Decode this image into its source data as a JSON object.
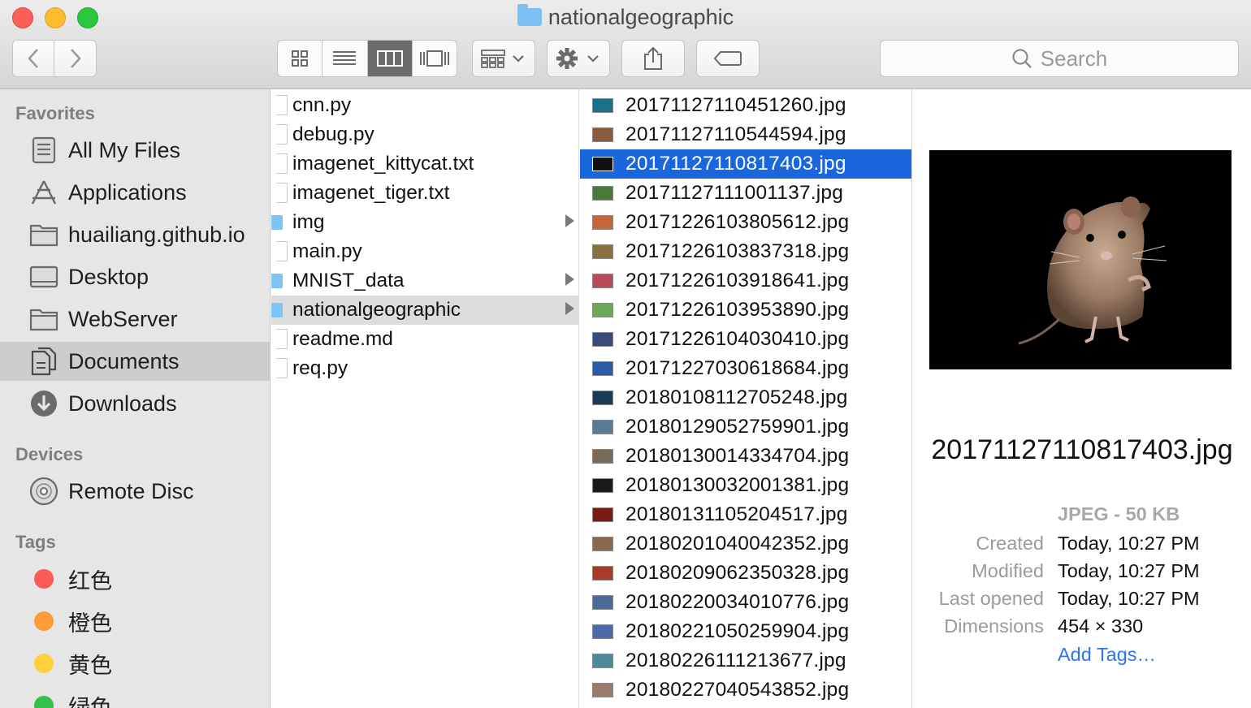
{
  "window": {
    "title": "nationalgeographic"
  },
  "toolbar": {
    "search_placeholder": "Search",
    "icons": [
      "back-chevron-icon",
      "forward-chevron-icon",
      "icon-view-icon",
      "list-view-icon",
      "column-view-icon",
      "cover-flow-icon",
      "arrange-icon",
      "gear-icon",
      "share-icon",
      "tag-icon",
      "magnifier-icon"
    ]
  },
  "sidebar": {
    "favorites_header": "Favorites",
    "favorites": [
      {
        "label": "All My Files",
        "icon": "all-files-icon"
      },
      {
        "label": "Applications",
        "icon": "applications-icon"
      },
      {
        "label": "huailiang.github.io",
        "icon": "folder-icon"
      },
      {
        "label": "Desktop",
        "icon": "desktop-icon"
      },
      {
        "label": "WebServer",
        "icon": "folder-icon"
      },
      {
        "label": "Documents",
        "icon": "documents-icon"
      },
      {
        "label": "Downloads",
        "icon": "download-icon"
      }
    ],
    "devices_header": "Devices",
    "devices": [
      {
        "label": "Remote Disc",
        "icon": "disc-icon"
      }
    ],
    "tags_header": "Tags",
    "tags": [
      {
        "label": "红色",
        "color": "#fc5a54"
      },
      {
        "label": "橙色",
        "color": "#fd9d3a"
      },
      {
        "label": "黄色",
        "color": "#fdd23c"
      },
      {
        "label": "绿色",
        "color": "#36c24a"
      }
    ]
  },
  "column1": {
    "items": [
      {
        "name": "cnn.py",
        "kind": "file"
      },
      {
        "name": "debug.py",
        "kind": "file"
      },
      {
        "name": "imagenet_kittycat.txt",
        "kind": "file"
      },
      {
        "name": "imagenet_tiger.txt",
        "kind": "file"
      },
      {
        "name": "img",
        "kind": "folder"
      },
      {
        "name": "main.py",
        "kind": "file"
      },
      {
        "name": "MNIST_data",
        "kind": "folder"
      },
      {
        "name": "nationalgeographic",
        "kind": "folder"
      },
      {
        "name": "readme.md",
        "kind": "file"
      },
      {
        "name": "req.py",
        "kind": "file"
      }
    ]
  },
  "column2": {
    "items": [
      {
        "name": "20171127110451260.jpg",
        "thumb": "#1a6f8a"
      },
      {
        "name": "20171127110544594.jpg",
        "thumb": "#8a5a3a"
      },
      {
        "name": "20171127110817403.jpg",
        "thumb": "#111111"
      },
      {
        "name": "20171127111001137.jpg",
        "thumb": "#4a7a3a"
      },
      {
        "name": "20171226103805612.jpg",
        "thumb": "#c8643c"
      },
      {
        "name": "20171226103837318.jpg",
        "thumb": "#8a7040"
      },
      {
        "name": "20171226103918641.jpg",
        "thumb": "#b84a5a"
      },
      {
        "name": "20171226103953890.jpg",
        "thumb": "#6aa85a"
      },
      {
        "name": "20171226104030410.jpg",
        "thumb": "#3a4a7a"
      },
      {
        "name": "20171227030618684.jpg",
        "thumb": "#2a5aa8"
      },
      {
        "name": "20180108112705248.jpg",
        "thumb": "#1a3a5a"
      },
      {
        "name": "20180129052759901.jpg",
        "thumb": "#5a7a9a"
      },
      {
        "name": "20180130014334704.jpg",
        "thumb": "#7a6a5a"
      },
      {
        "name": "20180130032001381.jpg",
        "thumb": "#1a1a1a"
      },
      {
        "name": "20180131105204517.jpg",
        "thumb": "#7a1a10"
      },
      {
        "name": "20180201040042352.jpg",
        "thumb": "#8a6a4a"
      },
      {
        "name": "20180209062350328.jpg",
        "thumb": "#a83a2a"
      },
      {
        "name": "20180220034010776.jpg",
        "thumb": "#4a6a9a"
      },
      {
        "name": "20180221050259904.jpg",
        "thumb": "#4a6aa8"
      },
      {
        "name": "20180226111213677.jpg",
        "thumb": "#4a8a9a"
      },
      {
        "name": "20180227040543852.jpg",
        "thumb": "#9a7a6a"
      }
    ]
  },
  "preview": {
    "filename": "20171127110817403.jpg",
    "type_size": "JPEG - 50 KB",
    "meta": [
      {
        "key": "Created",
        "value": "Today, 10:27 PM"
      },
      {
        "key": "Modified",
        "value": "Today, 10:27 PM"
      },
      {
        "key": "Last opened",
        "value": "Today, 10:27 PM"
      },
      {
        "key": "Dimensions",
        "value": "454 × 330"
      }
    ],
    "add_tags": "Add Tags…"
  }
}
